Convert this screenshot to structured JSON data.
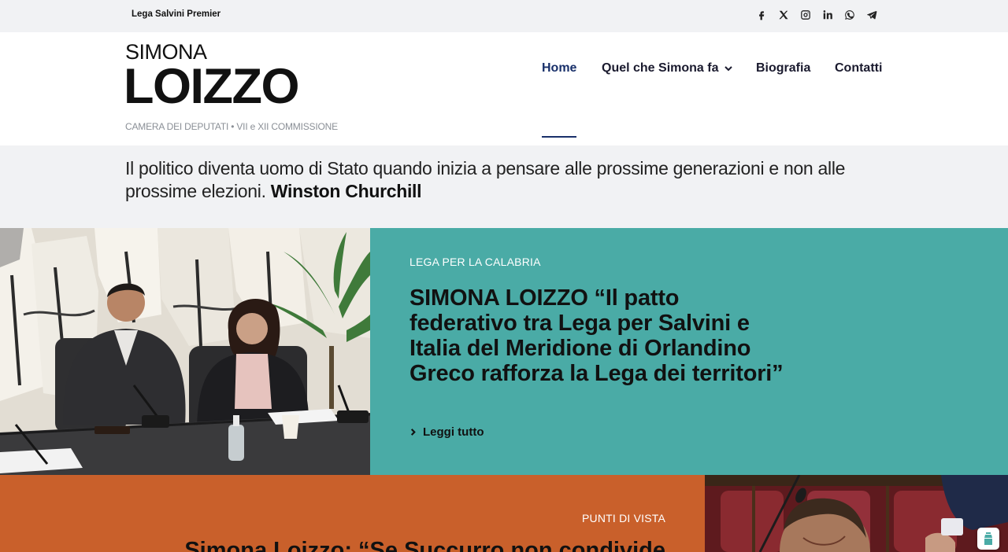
{
  "topbar": {
    "brand": "Lega Salvini Premier",
    "socials": [
      "facebook-icon",
      "x-icon",
      "instagram-icon",
      "linkedin-icon",
      "whatsapp-icon",
      "telegram-icon"
    ]
  },
  "header": {
    "logo_first": "SIMONA",
    "logo_last": "LOIZZO",
    "subtitle": "CAMERA DEI DEPUTATI • VII e XII COMMISSIONE"
  },
  "nav": {
    "items": [
      {
        "label": "Home",
        "active": true
      },
      {
        "label": "Quel che Simona fa",
        "has_dropdown": true
      },
      {
        "label": "Biografia"
      },
      {
        "label": "Contatti"
      }
    ],
    "active_color": "#19306a"
  },
  "quote": {
    "text": "Il politico diventa uomo di Stato quando inizia a pensare alle prossime generazioni e non alle prossime elezioni.",
    "author": "Winston Churchill"
  },
  "featured": [
    {
      "category": "LEGA PER LA CALABRIA",
      "title": "SIMONA LOIZZO “Il patto federativo tra Lega per Salvini e Italia del Meridione di Orlandino Greco rafforza la Lega dei territori”",
      "read_more": "Leggi tutto",
      "panel_color": "#4aaba6"
    },
    {
      "category": "PUNTI DI VISTA",
      "title": "Simona Loizzo: “Se Succurro non condivide",
      "panel_color": "#c9602b"
    }
  ]
}
